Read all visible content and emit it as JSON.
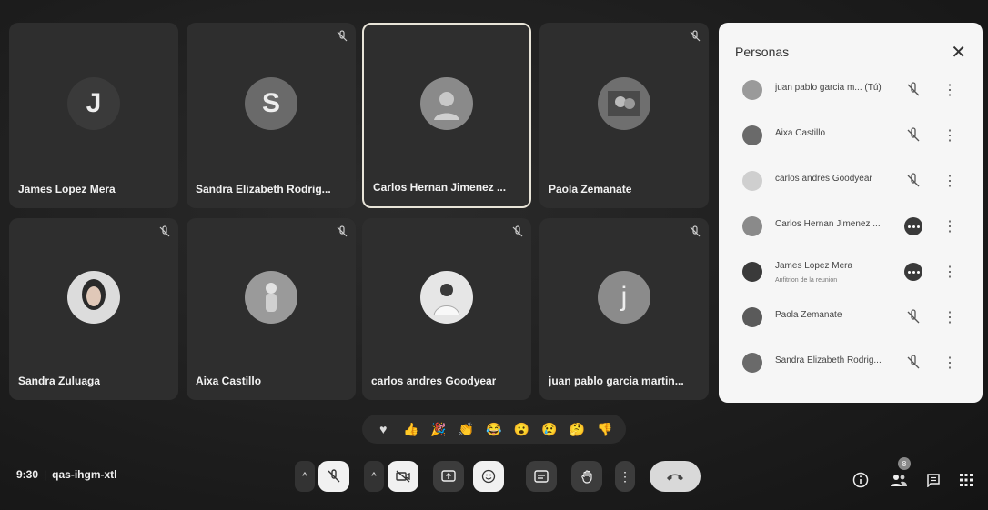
{
  "tiles": [
    {
      "name": "James Lopez Mera",
      "initial": "J",
      "avatar_color": "#3a3a3a"
    },
    {
      "name": "Sandra Elizabeth Rodrig...",
      "initial": "S",
      "avatar_color": "#6a6a6a"
    },
    {
      "name": "Carlos Hernan Jimenez ...",
      "initial": "",
      "avatar_color": "#8a8a8a"
    },
    {
      "name": "Paola Zemanate",
      "initial": "",
      "avatar_color": "#6f6f6f"
    },
    {
      "name": "Sandra Zuluaga",
      "initial": "",
      "avatar_color": "#dcdcdc"
    },
    {
      "name": "Aixa Castillo",
      "initial": "",
      "avatar_color": "#9a9a9a"
    },
    {
      "name": "carlos andres Goodyear",
      "initial": "",
      "avatar_color": "#e6e6e6"
    },
    {
      "name": "juan pablo garcia martin...",
      "initial": "j",
      "avatar_color": "#8b8b8b"
    }
  ],
  "people_panel": {
    "title": "Personas",
    "close": "✕",
    "participants": [
      {
        "name": "juan pablo garcia m... (Tú)",
        "subtitle": "",
        "status": "muted"
      },
      {
        "name": "Aixa Castillo",
        "subtitle": "",
        "status": "muted"
      },
      {
        "name": "carlos andres Goodyear",
        "subtitle": "",
        "status": "muted"
      },
      {
        "name": "Carlos Hernan Jimenez ...",
        "subtitle": "",
        "status": "speaking"
      },
      {
        "name": "James Lopez Mera",
        "subtitle": "Anfitrion de la reunion",
        "status": "speaking"
      },
      {
        "name": "Paola Zemanate",
        "subtitle": "",
        "status": "muted"
      },
      {
        "name": "Sandra Elizabeth Rodrig...",
        "subtitle": "",
        "status": "muted"
      }
    ]
  },
  "reactions": [
    "♥",
    "👍",
    "🎉",
    "👏",
    "😂",
    "😮",
    "😢",
    "🤔",
    "👎"
  ],
  "meeting": {
    "time": "9:30",
    "separator": "|",
    "code": "qas-ihgm-xtl"
  },
  "people_count": "8",
  "colors": {
    "panel_bg": "#f6f6f6",
    "tile_bg": "#2e2e2e",
    "bar_bg": "#1c1c1c"
  }
}
